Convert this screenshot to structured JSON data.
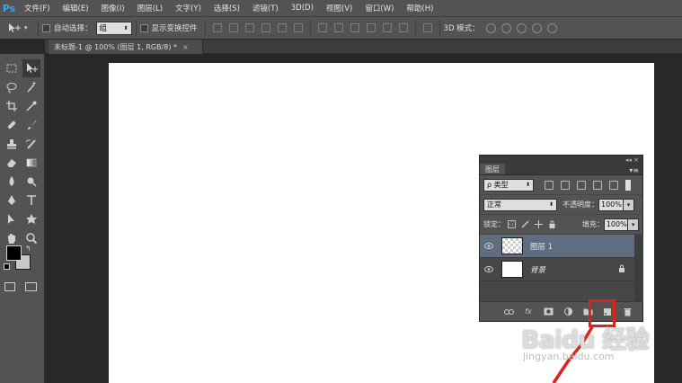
{
  "app": {
    "logo": "Ps"
  },
  "menu": [
    "文件(F)",
    "编辑(E)",
    "图像(I)",
    "图层(L)",
    "文字(Y)",
    "选择(S)",
    "滤镜(T)",
    "3D(D)",
    "视图(V)",
    "窗口(W)",
    "帮助(H)"
  ],
  "options": {
    "auto_select_label": "自动选择：",
    "auto_select_value": "组",
    "show_transform_label": "显示变换控件",
    "mode3d_label": "3D 模式："
  },
  "document": {
    "tab_title": "未标题-1 @ 100% (图层 1, RGB/8) *",
    "close_glyph": "×"
  },
  "layers_panel": {
    "top_glyphs": "◂◂ ×",
    "tab_label": "图层",
    "menu_glyph": "▾≡",
    "filter_type": "ρ 类型",
    "blend_mode": "正常",
    "opacity_label": "不透明度：",
    "opacity_value": "100%",
    "lock_label": "锁定：",
    "fill_label": "填充：",
    "fill_value": "100%",
    "layers": [
      {
        "name": "图层 1",
        "selected": true
      },
      {
        "name": "背景",
        "selected": false
      }
    ],
    "bottom_icons": [
      "link-icon",
      "fx-icon",
      "mask-icon",
      "adjustment-icon",
      "folder-icon",
      "new-layer-icon",
      "trash-icon"
    ],
    "fx_label": "fx"
  },
  "colors": {
    "foreground": "#000000",
    "background": "#c8c8c8",
    "highlight": "#e0201b",
    "selected_layer": "#5f6d80"
  },
  "watermark": {
    "main": "Baidu 经验",
    "sub": "jingyan.baidu.com"
  }
}
